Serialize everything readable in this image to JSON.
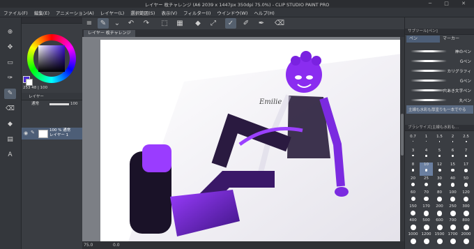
{
  "window": {
    "title": "レイヤー 枚チャレンジ (A6 2039 x 1447px 350dpi 75.0%) - CLIP STUDIO PAINT PRO"
  },
  "menu": [
    "ファイル(F)",
    "編集(E)",
    "アニメーション(A)",
    "レイヤー(L)",
    "選択範囲(S)",
    "表示(V)",
    "フィルター(I)",
    "ウインドウ(W)",
    "ヘルプ(H)"
  ],
  "tab": {
    "label": "レイヤー 枚チャレンジ"
  },
  "canvas": {
    "signature": "Emilie"
  },
  "color": {
    "hsv_readout": "253 48 | 100",
    "main": "#4b2bd8",
    "sub": "#ffffff"
  },
  "layers": {
    "header": "レイヤー",
    "blend_mode": "通常",
    "opacity": "100",
    "row": {
      "line1": "100 % 通常",
      "line2": "レイヤー 1"
    }
  },
  "subtool": {
    "header": "サブツール[ペン]",
    "tabs": [
      "ペン",
      "マーカー"
    ],
    "brushes": [
      {
        "label": "神のペン"
      },
      {
        "label": "Gペン"
      },
      {
        "label": "カリグラフィ"
      },
      {
        "label": "Gペン"
      },
      {
        "label": "穴あき文字ペン"
      },
      {
        "label": "丸ペン"
      }
    ],
    "selected_brush": "主線も水彩も厚塗りも一本でやる"
  },
  "brush_size": {
    "header": "ブラシサイズ[主線も水彩も…",
    "sizes": [
      "0.7",
      "1",
      "1.5",
      "2",
      "2.5",
      "3",
      "4",
      "5",
      "6",
      "7",
      "8",
      "10",
      "12",
      "15",
      "17",
      "20",
      "25",
      "30",
      "40",
      "50",
      "60",
      "70",
      "80",
      "100",
      "120",
      "150",
      "170",
      "200",
      "250",
      "300",
      "400",
      "500",
      "600",
      "700",
      "800",
      "1000",
      "1200",
      "1500",
      "1700",
      "2000"
    ],
    "selected": "10"
  },
  "status": {
    "zoom": "75.0",
    "rotate": "0.0"
  }
}
